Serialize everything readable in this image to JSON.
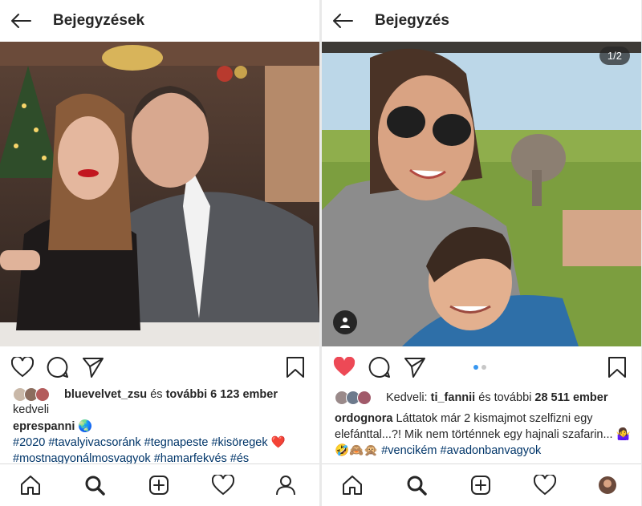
{
  "left": {
    "title": "Bejegyzések",
    "likes": {
      "user": "bluevelvet_zsu",
      "and": "és",
      "others": "további 6 123 ember",
      "suffix": "kedveli"
    },
    "caption": {
      "user": "eprespanni",
      "emoji1": "🌏",
      "tags_line1": "#2020 #tavalyivacsoránk #tegnapeste #kisöregek",
      "heart": "❤️",
      "tags_line2": "#mostnagyonálmosvagyok #hamarfekvés #és"
    }
  },
  "right": {
    "title": "Bejegyzés",
    "counter": "1/2",
    "likes": {
      "prefix": "Kedveli:",
      "user": "ti_fannii",
      "and": "és további",
      "others": "28 511 ember"
    },
    "caption": {
      "user": "ordognora",
      "text": "Láttatok már 2 kismajmot szelfizni egy elefánttal...?! Mik nem történnek egy hajnali szafarin...",
      "emojis": "🤷‍♀️🤣🙈🙊",
      "tags": "#vencikém #avadonbanvagyok"
    }
  },
  "icons": {
    "back": "arrow-left",
    "like": "heart",
    "comment": "speech-bubble",
    "share": "paper-plane",
    "save": "bookmark",
    "nav_home": "home",
    "nav_search": "magnifier",
    "nav_add": "plus-square",
    "nav_activity": "heart",
    "nav_profile": "person"
  },
  "colors": {
    "liked": "#ed4956",
    "link": "#003569",
    "dot_active": "#3897f0"
  }
}
